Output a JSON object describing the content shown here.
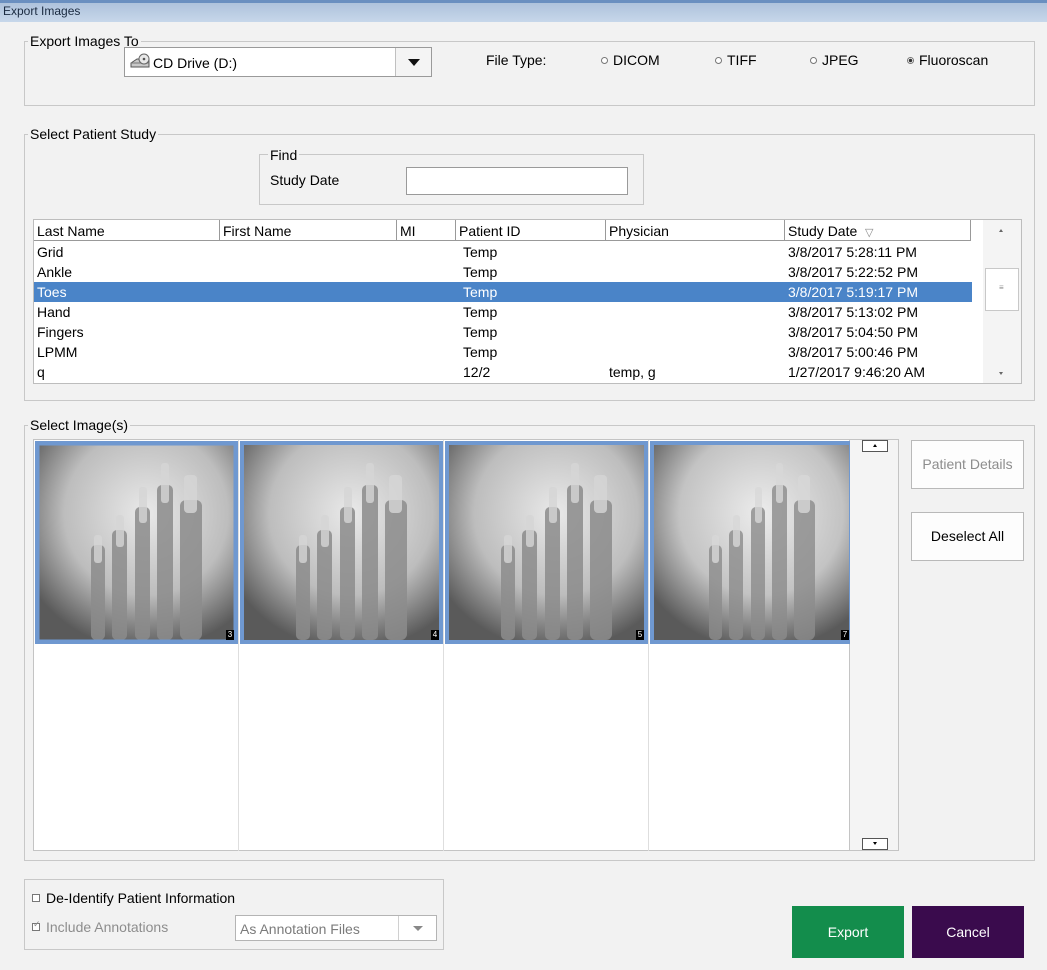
{
  "window": {
    "title": "Export Images"
  },
  "export_to": {
    "legend": "Export Images To",
    "drive": "CD Drive (D:)",
    "file_type_label": "File Type:",
    "file_types": [
      {
        "label": "DICOM",
        "checked": false
      },
      {
        "label": "TIFF",
        "checked": false
      },
      {
        "label": "JPEG",
        "checked": false
      },
      {
        "label": "Fluoroscan",
        "checked": true
      }
    ]
  },
  "patient_study": {
    "legend": "Select Patient Study",
    "find": {
      "legend": "Find",
      "study_date_label": "Study Date",
      "study_date_value": ""
    },
    "columns": [
      "Last Name",
      "First Name",
      "MI",
      "Patient ID",
      "Physician",
      "Study Date"
    ],
    "sort_indicator": "▽",
    "rows": [
      {
        "last": "Grid",
        "first": "",
        "mi": "",
        "pid": "Temp",
        "physician": "",
        "date": "3/8/2017 5:28:11 PM",
        "selected": false
      },
      {
        "last": "Ankle",
        "first": "",
        "mi": "",
        "pid": "Temp",
        "physician": "",
        "date": "3/8/2017 5:22:52 PM",
        "selected": false
      },
      {
        "last": "Toes",
        "first": "",
        "mi": "",
        "pid": "Temp",
        "physician": "",
        "date": "3/8/2017 5:19:17 PM",
        "selected": true
      },
      {
        "last": "Hand",
        "first": "",
        "mi": "",
        "pid": "Temp",
        "physician": "",
        "date": "3/8/2017 5:13:02 PM",
        "selected": false
      },
      {
        "last": "Fingers",
        "first": "",
        "mi": "",
        "pid": "Temp",
        "physician": "",
        "date": "3/8/2017 5:04:50 PM",
        "selected": false
      },
      {
        "last": "LPMM",
        "first": "",
        "mi": "",
        "pid": "Temp",
        "physician": "",
        "date": "3/8/2017 5:00:46 PM",
        "selected": false
      },
      {
        "last": "q",
        "first": "",
        "mi": "",
        "pid": "12/2",
        "physician": "temp, g",
        "date": "1/27/2017 9:46:20 AM",
        "selected": false
      }
    ]
  },
  "images": {
    "legend": "Select Image(s)",
    "thumbnails": [
      {
        "number": "3",
        "selected": true
      },
      {
        "number": "4",
        "selected": true
      },
      {
        "number": "5",
        "selected": true
      },
      {
        "number": "7",
        "selected": true
      }
    ],
    "patient_details_label": "Patient Details",
    "deselect_all_label": "Deselect All"
  },
  "options": {
    "deidentify_label": "De-Identify Patient Information",
    "deidentify_checked": false,
    "include_annotations_label": "Include Annotations",
    "include_annotations_checked": true,
    "annotation_format": "As Annotation Files"
  },
  "actions": {
    "export_label": "Export",
    "cancel_label": "Cancel",
    "export_color": "#138d4c",
    "cancel_color": "#3a0b4d"
  }
}
